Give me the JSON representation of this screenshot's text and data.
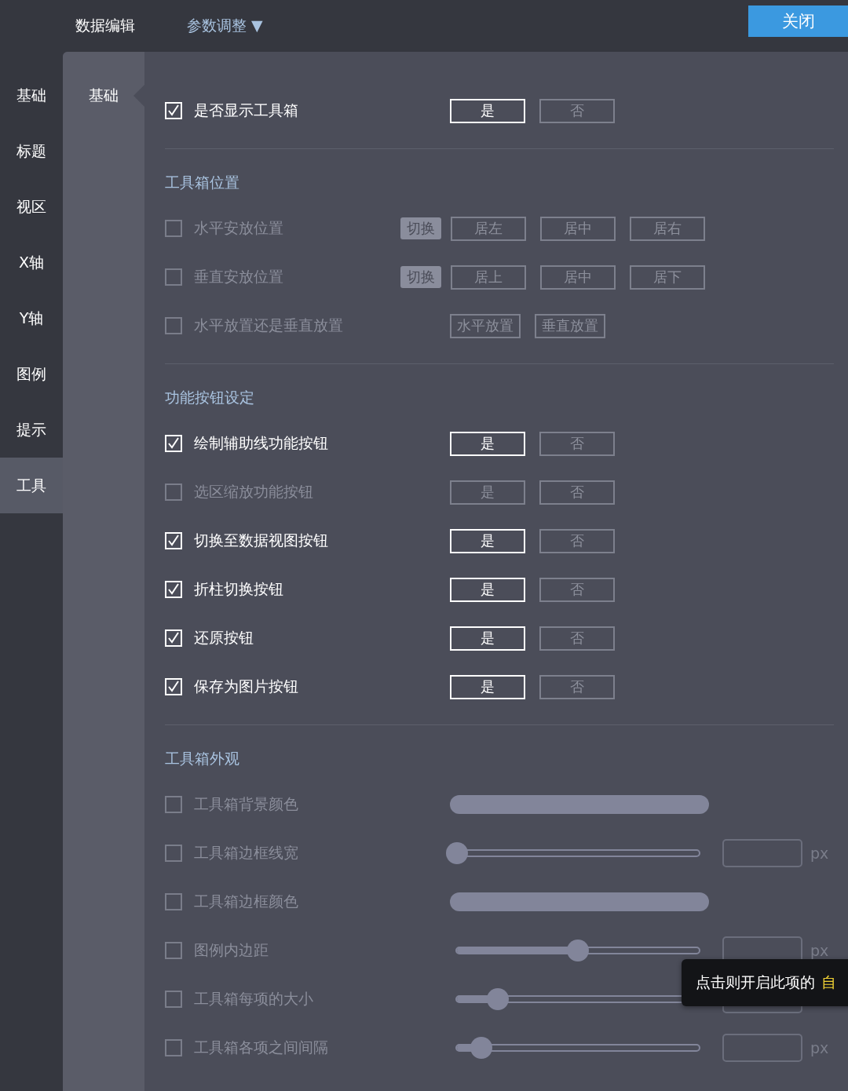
{
  "top_tabs": [
    {
      "label": "数据编辑",
      "selected": false
    },
    {
      "label": "参数调整",
      "caret": "▼",
      "selected": true
    }
  ],
  "close_button": "关闭",
  "sidebar": {
    "items": [
      {
        "label": "基础",
        "selected": false
      },
      {
        "label": "标题",
        "selected": false
      },
      {
        "label": "视区",
        "selected": false
      },
      {
        "label": "X轴",
        "selected": false
      },
      {
        "label": "Y轴",
        "selected": false
      },
      {
        "label": "图例",
        "selected": false
      },
      {
        "label": "提示",
        "selected": false
      },
      {
        "label": "工具",
        "selected": true
      }
    ]
  },
  "subsidebar": {
    "items": [
      {
        "label": "基础",
        "selected": true
      }
    ]
  },
  "sections": [
    {
      "rows": [
        {
          "kind": "toggle",
          "label": "是否显示工具箱",
          "checked": true,
          "options": [
            {
              "label": "是",
              "selected": true
            },
            {
              "label": "否",
              "selected": false
            }
          ]
        }
      ]
    },
    {
      "title": "工具箱位置",
      "rows": [
        {
          "kind": "toggle",
          "label": "水平安放位置",
          "checked": false,
          "tag": "切换",
          "options": [
            {
              "label": "居左",
              "selected": false
            },
            {
              "label": "居中",
              "selected": false
            },
            {
              "label": "居右",
              "selected": false
            }
          ]
        },
        {
          "kind": "toggle",
          "label": "垂直安放位置",
          "checked": false,
          "tag": "切换",
          "options": [
            {
              "label": "居上",
              "selected": false
            },
            {
              "label": "居中",
              "selected": false
            },
            {
              "label": "居下",
              "selected": false
            }
          ]
        },
        {
          "kind": "choice",
          "label": "水平放置还是垂直放置",
          "checked": false,
          "options": [
            {
              "label": "水平放置",
              "selected": false
            },
            {
              "label": "垂直放置",
              "selected": false
            }
          ]
        }
      ]
    },
    {
      "title": "功能按钮设定",
      "rows": [
        {
          "kind": "toggle",
          "label": "绘制辅助线功能按钮",
          "checked": true,
          "options": [
            {
              "label": "是",
              "selected": true
            },
            {
              "label": "否",
              "selected": false
            }
          ]
        },
        {
          "kind": "toggle",
          "label": "选区缩放功能按钮",
          "checked": false,
          "options": [
            {
              "label": "是",
              "selected": false
            },
            {
              "label": "否",
              "selected": false
            }
          ]
        },
        {
          "kind": "toggle",
          "label": "切换至数据视图按钮",
          "checked": true,
          "options": [
            {
              "label": "是",
              "selected": true
            },
            {
              "label": "否",
              "selected": false
            }
          ]
        },
        {
          "kind": "toggle",
          "label": "折柱切换按钮",
          "checked": true,
          "options": [
            {
              "label": "是",
              "selected": true
            },
            {
              "label": "否",
              "selected": false
            }
          ]
        },
        {
          "kind": "toggle",
          "label": "还原按钮",
          "checked": true,
          "options": [
            {
              "label": "是",
              "selected": true
            },
            {
              "label": "否",
              "selected": false
            }
          ]
        },
        {
          "kind": "toggle",
          "label": "保存为图片按钮",
          "checked": true,
          "options": [
            {
              "label": "是",
              "selected": true
            },
            {
              "label": "否",
              "selected": false
            }
          ]
        }
      ]
    },
    {
      "title": "工具箱外观",
      "rows": [
        {
          "kind": "color",
          "label": "工具箱背景颜色",
          "checked": false
        },
        {
          "kind": "slider",
          "label": "工具箱边框线宽",
          "checked": false,
          "level": 0,
          "unit": "px"
        },
        {
          "kind": "color",
          "label": "工具箱边框颜色",
          "checked": false
        },
        {
          "kind": "slider",
          "label": "图例内边距",
          "checked": false,
          "level": 0.5,
          "unit": "px"
        },
        {
          "kind": "slider",
          "label": "工具箱每项的大小",
          "checked": false,
          "level": 0.17
        },
        {
          "kind": "slider",
          "label": "工具箱各项之间间隔",
          "checked": false,
          "level": 0.1,
          "unit": "px"
        }
      ]
    }
  ],
  "tooltip": {
    "text": "点击则开启此项的",
    "highlight": "自"
  }
}
